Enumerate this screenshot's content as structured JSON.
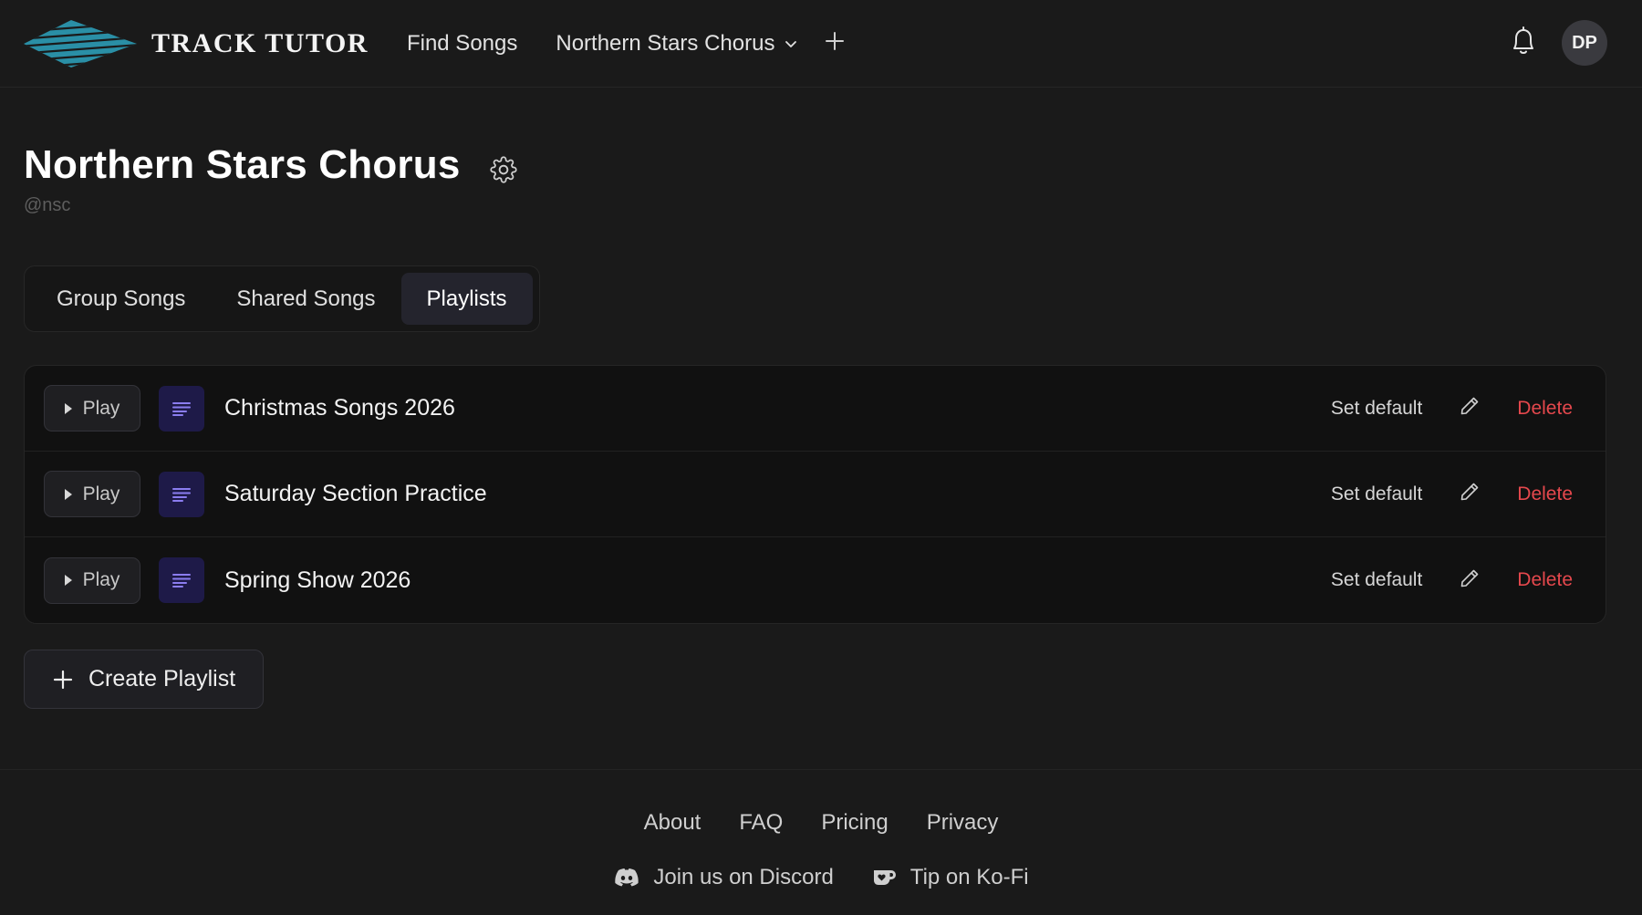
{
  "brand": {
    "name": "TRACK TUTOR",
    "logo_color": "#2a8fa6"
  },
  "nav": {
    "find_songs": "Find Songs",
    "group_switcher": "Northern Stars Chorus",
    "avatar_initials": "DP"
  },
  "group": {
    "title": "Northern Stars Chorus",
    "handle": "@nsc"
  },
  "tabs": [
    {
      "label": "Group Songs",
      "active": false
    },
    {
      "label": "Shared Songs",
      "active": false
    },
    {
      "label": "Playlists",
      "active": true
    }
  ],
  "playlists": [
    {
      "name": "Christmas Songs 2026",
      "play": "Play",
      "set_default": "Set default",
      "delete": "Delete"
    },
    {
      "name": "Saturday Section Practice",
      "play": "Play",
      "set_default": "Set default",
      "delete": "Delete"
    },
    {
      "name": "Spring Show 2026",
      "play": "Play",
      "set_default": "Set default",
      "delete": "Delete"
    }
  ],
  "create_playlist": "Create Playlist",
  "footer": {
    "links": [
      "About",
      "FAQ",
      "Pricing",
      "Privacy"
    ],
    "discord": "Join us on Discord",
    "kofi": "Tip on Ko-Fi"
  },
  "colors": {
    "background": "#1a1a1a",
    "delete": "#e5484d",
    "playlist_icon_bg": "#1e1a48",
    "playlist_icon_fg": "#8b7df0"
  },
  "icons": [
    "logo-icon",
    "chevron-down-icon",
    "plus-icon",
    "bell-icon",
    "gear-icon",
    "play-icon",
    "list-icon",
    "pencil-icon",
    "discord-icon",
    "kofi-icon"
  ]
}
